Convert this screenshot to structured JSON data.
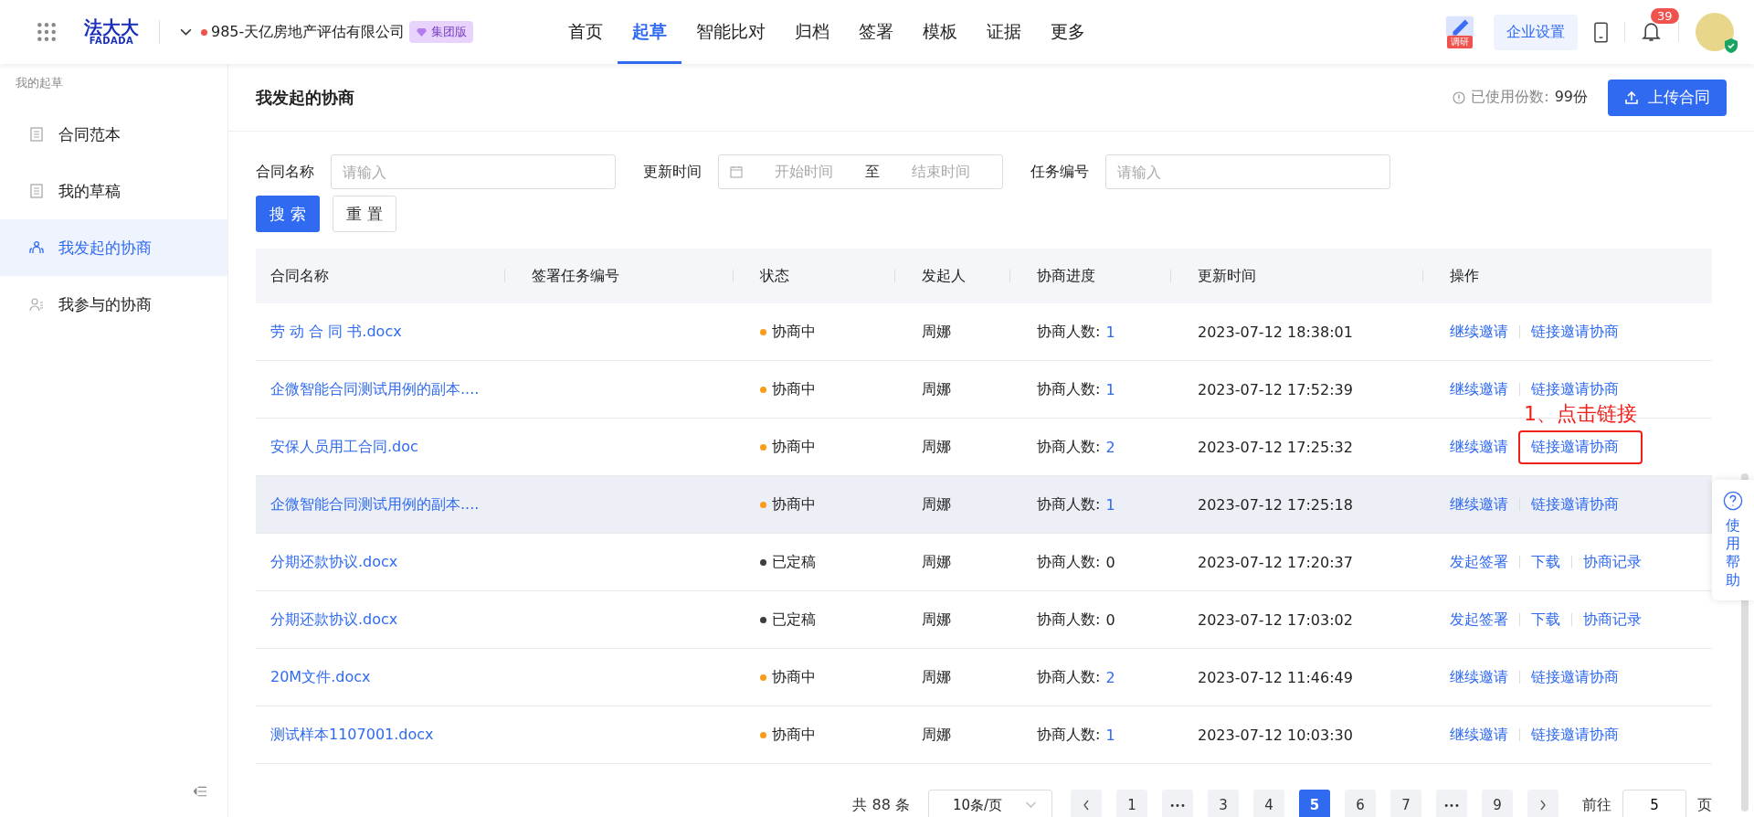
{
  "header": {
    "logo_cn": "法大大",
    "logo_en": "FADADA",
    "company": "985-天亿房地产评估有限公司",
    "edition_badge": "集团版",
    "nav": [
      {
        "label": "首页",
        "selected": false
      },
      {
        "label": "起草",
        "selected": true
      },
      {
        "label": "智能比对",
        "selected": false
      },
      {
        "label": "归档",
        "selected": false
      },
      {
        "label": "签署",
        "selected": false
      },
      {
        "label": "模板",
        "selected": false
      },
      {
        "label": "证据",
        "selected": false
      },
      {
        "label": "更多",
        "selected": false
      }
    ],
    "survey_label": "调研",
    "settings_button": "企业设置",
    "notification_count": "39"
  },
  "sidebar": {
    "section_title": "我的起草",
    "items": [
      {
        "label": "合同范本",
        "selected": false
      },
      {
        "label": "我的草稿",
        "selected": false
      },
      {
        "label": "我发起的协商",
        "selected": true
      },
      {
        "label": "我参与的协商",
        "selected": false
      }
    ]
  },
  "page": {
    "title": "我发起的协商",
    "usage_label": "已使用份数:",
    "usage_value": "99份",
    "upload_button": "上传合同"
  },
  "filters": {
    "name_label": "合同名称",
    "name_placeholder": "请输入",
    "time_label": "更新时间",
    "start_placeholder": "开始时间",
    "range_sep": "至",
    "end_placeholder": "结束时间",
    "task_label": "任务编号",
    "task_placeholder": "请输入",
    "search_button": "搜 索",
    "reset_button": "重 置"
  },
  "table": {
    "columns": [
      "合同名称",
      "签署任务编号",
      "状态",
      "发起人",
      "协商进度",
      "更新时间",
      "操作"
    ],
    "rows": [
      {
        "name": "劳 动 合 同 书.docx",
        "status": "协商中",
        "color": "#fa9c1a",
        "initiator": "周娜",
        "progress_label": "协商人数:",
        "progress_count": "1",
        "linked": true,
        "time": "2023-07-12 18:38:01",
        "hovered": false,
        "actions": [
          {
            "label": "继续邀请",
            "highlighted": false
          },
          {
            "label": "链接邀请协商",
            "highlighted": false
          }
        ]
      },
      {
        "name": "企微智能合同测试用例的副本....",
        "status": "协商中",
        "color": "#fa9c1a",
        "initiator": "周娜",
        "progress_label": "协商人数:",
        "progress_count": "1",
        "linked": true,
        "time": "2023-07-12 17:52:39",
        "hovered": false,
        "actions": [
          {
            "label": "继续邀请",
            "highlighted": false
          },
          {
            "label": "链接邀请协商",
            "highlighted": false
          }
        ]
      },
      {
        "name": "安保人员用工合同.doc",
        "status": "协商中",
        "color": "#fa9c1a",
        "initiator": "周娜",
        "progress_label": "协商人数:",
        "progress_count": "2",
        "linked": true,
        "time": "2023-07-12 17:25:32",
        "hovered": false,
        "actions": [
          {
            "label": "继续邀请",
            "highlighted": false
          },
          {
            "label": "链接邀请协商",
            "highlighted": true
          }
        ]
      },
      {
        "name": "企微智能合同测试用例的副本....",
        "status": "协商中",
        "color": "#fa9c1a",
        "initiator": "周娜",
        "progress_label": "协商人数:",
        "progress_count": "1",
        "linked": true,
        "time": "2023-07-12 17:25:18",
        "hovered": true,
        "actions": [
          {
            "label": "继续邀请",
            "highlighted": false
          },
          {
            "label": "链接邀请协商",
            "highlighted": false
          }
        ]
      },
      {
        "name": "分期还款协议.docx",
        "status": "已定稿",
        "color": "#3d3d3d",
        "initiator": "周娜",
        "progress_label": "协商人数:",
        "progress_count": "0",
        "linked": false,
        "time": "2023-07-12 17:20:37",
        "hovered": false,
        "actions": [
          {
            "label": "发起签署",
            "highlighted": false
          },
          {
            "label": "下载",
            "highlighted": false
          },
          {
            "label": "协商记录",
            "highlighted": false
          }
        ]
      },
      {
        "name": "分期还款协议.docx",
        "status": "已定稿",
        "color": "#3d3d3d",
        "initiator": "周娜",
        "progress_label": "协商人数:",
        "progress_count": "0",
        "linked": false,
        "time": "2023-07-12 17:03:02",
        "hovered": false,
        "actions": [
          {
            "label": "发起签署",
            "highlighted": false
          },
          {
            "label": "下载",
            "highlighted": false
          },
          {
            "label": "协商记录",
            "highlighted": false
          }
        ]
      },
      {
        "name": "20M文件.docx",
        "status": "协商中",
        "color": "#fa9c1a",
        "initiator": "周娜",
        "progress_label": "协商人数:",
        "progress_count": "2",
        "linked": true,
        "time": "2023-07-12 11:46:49",
        "hovered": false,
        "actions": [
          {
            "label": "继续邀请",
            "highlighted": false
          },
          {
            "label": "链接邀请协商",
            "highlighted": false
          }
        ]
      },
      {
        "name": "测试样本1107001.docx",
        "status": "协商中",
        "color": "#fa9c1a",
        "initiator": "周娜",
        "progress_label": "协商人数:",
        "progress_count": "1",
        "linked": true,
        "time": "2023-07-12 10:03:30",
        "hovered": false,
        "actions": [
          {
            "label": "继续邀请",
            "highlighted": false
          },
          {
            "label": "链接邀请协商",
            "highlighted": false
          }
        ]
      }
    ]
  },
  "annotation": "1、点击链接",
  "pagination": {
    "total": "共 88 条",
    "page_size": "10条/页",
    "pages": [
      {
        "label": "1",
        "kind": "page",
        "selected": false
      },
      {
        "label": "•••",
        "kind": "more",
        "selected": false
      },
      {
        "label": "3",
        "kind": "page",
        "selected": false
      },
      {
        "label": "4",
        "kind": "page",
        "selected": false
      },
      {
        "label": "5",
        "kind": "page",
        "selected": true
      },
      {
        "label": "6",
        "kind": "page",
        "selected": false
      },
      {
        "label": "7",
        "kind": "page",
        "selected": false
      },
      {
        "label": "•••",
        "kind": "more",
        "selected": false
      },
      {
        "label": "9",
        "kind": "page",
        "selected": false
      }
    ],
    "goto_label": "前往",
    "goto_value": "5",
    "page_unit": "页"
  },
  "help_tab": "使用帮助"
}
